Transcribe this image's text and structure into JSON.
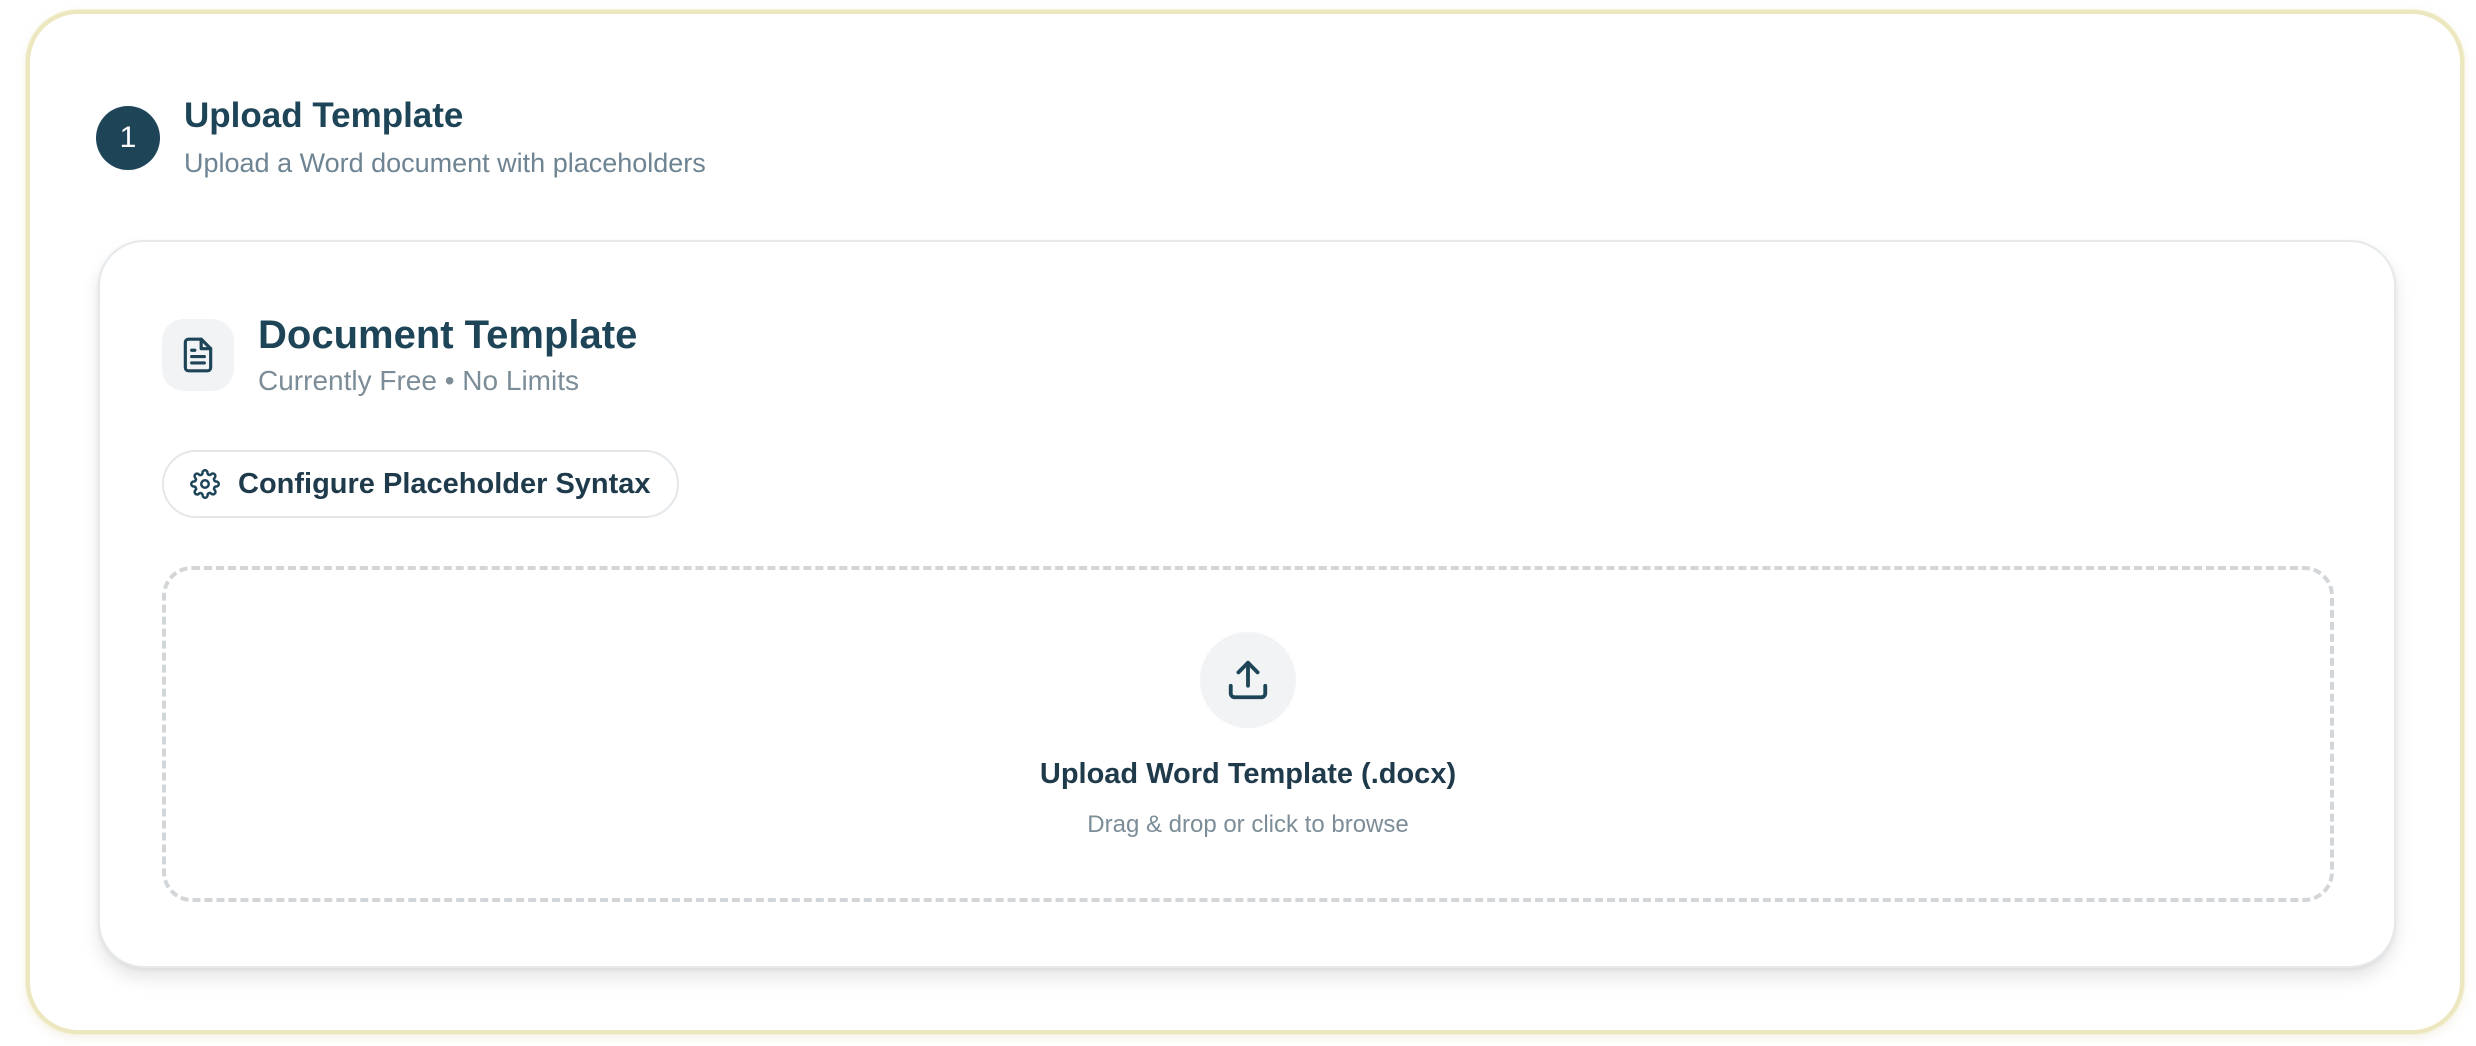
{
  "step": {
    "number": "1",
    "title": "Upload Template",
    "subtitle": "Upload a Word document with placeholders"
  },
  "document": {
    "title": "Document Template",
    "subtitle": "Currently Free • No Limits",
    "icon": "file-text-icon"
  },
  "config_button": {
    "label": "Configure Placeholder Syntax",
    "icon": "gear-icon"
  },
  "dropzone": {
    "title": "Upload Word Template (.docx)",
    "subtitle": "Drag & drop or click to browse",
    "icon": "upload-icon"
  },
  "colors": {
    "primary": "#1d4457",
    "muted_text": "#7c8d98",
    "outer_border": "#ece7bf",
    "dashed_border": "#d3d6d9",
    "icon_bg": "#f1f3f5"
  }
}
